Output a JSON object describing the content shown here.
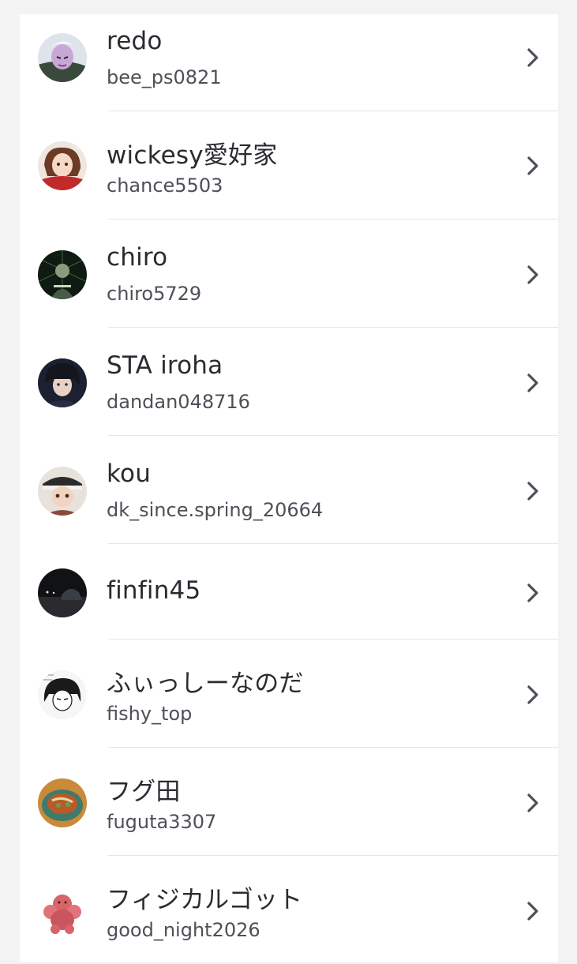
{
  "friends": [
    {
      "name": "redo",
      "handle": "bee_ps0821",
      "avatar": "anime-character-avatar"
    },
    {
      "name": "wickesy愛好家",
      "handle": "chance5503",
      "avatar": "anime-girl-avatar"
    },
    {
      "name": "chiro",
      "handle": "chiro5729",
      "avatar": "dark-photo-avatar"
    },
    {
      "name": "STA iroha",
      "handle": "dandan048716",
      "avatar": "anime-boy-avatar"
    },
    {
      "name": "kou",
      "handle": "dk_since.spring_20664",
      "avatar": "anime-boy-cap-avatar"
    },
    {
      "name": "finfin45",
      "handle": "",
      "avatar": "night-photo-avatar"
    },
    {
      "name": "ふぃっしーなのだ",
      "handle": "fishy_top",
      "avatar": "manga-drawing-avatar"
    },
    {
      "name": "フグ田",
      "handle": "fuguta3307",
      "avatar": "food-photo-avatar"
    },
    {
      "name": "フィジカルゴット",
      "handle": "good_night2026",
      "avatar": "pink-creature-avatar"
    }
  ],
  "colors": {
    "background": "#f3f3f4",
    "card": "#ffffff",
    "name_text": "#2a2b30",
    "handle_text": "#4e5058",
    "divider": "#e4e5e8",
    "chevron": "#4e5058"
  },
  "icons": {
    "row_action": "chevron-right-icon"
  }
}
